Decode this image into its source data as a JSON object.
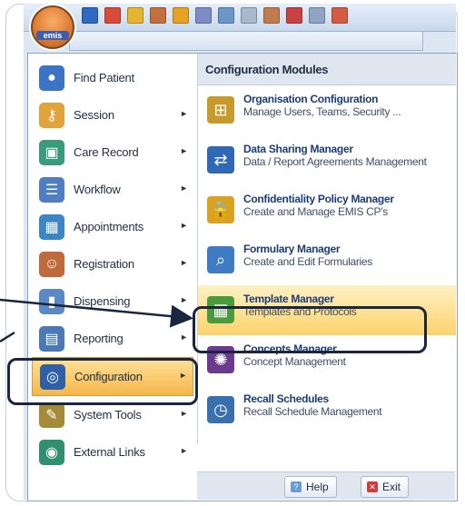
{
  "app": {
    "logo_text": "emis"
  },
  "left_menu": [
    {
      "label": "Find Patient",
      "icon": "find-patient-icon",
      "color": "#3b73c5",
      "arrow": false
    },
    {
      "label": "Session",
      "icon": "key-icon",
      "color": "#e0a43a",
      "arrow": true
    },
    {
      "label": "Care Record",
      "icon": "care-record-icon",
      "color": "#3a9b7a",
      "arrow": true
    },
    {
      "label": "Workflow",
      "icon": "workflow-icon",
      "color": "#4f7fc0",
      "arrow": true
    },
    {
      "label": "Appointments",
      "icon": "appointments-icon",
      "color": "#3d86c6",
      "arrow": true
    },
    {
      "label": "Registration",
      "icon": "registration-icon",
      "color": "#c06a3b",
      "arrow": true
    },
    {
      "label": "Dispensing",
      "icon": "dispensing-icon",
      "color": "#5a89c6",
      "arrow": true
    },
    {
      "label": "Reporting",
      "icon": "reporting-icon",
      "color": "#4a79b8",
      "arrow": true
    },
    {
      "label": "Configuration",
      "icon": "configuration-icon",
      "color": "#2e5fa7",
      "arrow": true,
      "active": true
    },
    {
      "label": "System Tools",
      "icon": "system-tools-icon",
      "color": "#a58a3a",
      "arrow": true
    },
    {
      "label": "External Links",
      "icon": "globe-icon",
      "color": "#2f8f6e",
      "arrow": true
    }
  ],
  "right_panel": {
    "header": "Configuration Modules",
    "items": [
      {
        "title": "Organisation Configuration",
        "desc": "Manage Users, Teams, Security ...",
        "icon": "org-config-icon",
        "color": "#c79a2c"
      },
      {
        "title": "Data Sharing Manager",
        "desc": "Data / Report Agreements Management",
        "icon": "data-sharing-icon",
        "color": "#2f68b6"
      },
      {
        "title": "Confidentiality Policy Manager",
        "desc": "Create and Manage EMIS CP's",
        "icon": "lock-icon",
        "color": "#d9a321"
      },
      {
        "title": "Formulary Manager",
        "desc": "Create and Edit Formularies",
        "icon": "formulary-icon",
        "color": "#3f7cc4"
      },
      {
        "title": "Template Manager",
        "desc": "Templates and Protocols",
        "icon": "template-grid-icon",
        "color": "#4c9a3e",
        "highlight": true
      },
      {
        "title": "Concepts Manager",
        "desc": "Concept Management",
        "icon": "atom-icon",
        "color": "#6b3a8f"
      },
      {
        "title": "Recall Schedules",
        "desc": "Recall Schedule Management",
        "icon": "clock-icon",
        "color": "#3a6fb0"
      }
    ]
  },
  "bottom": {
    "help_label": "Help",
    "exit_label": "Exit"
  }
}
